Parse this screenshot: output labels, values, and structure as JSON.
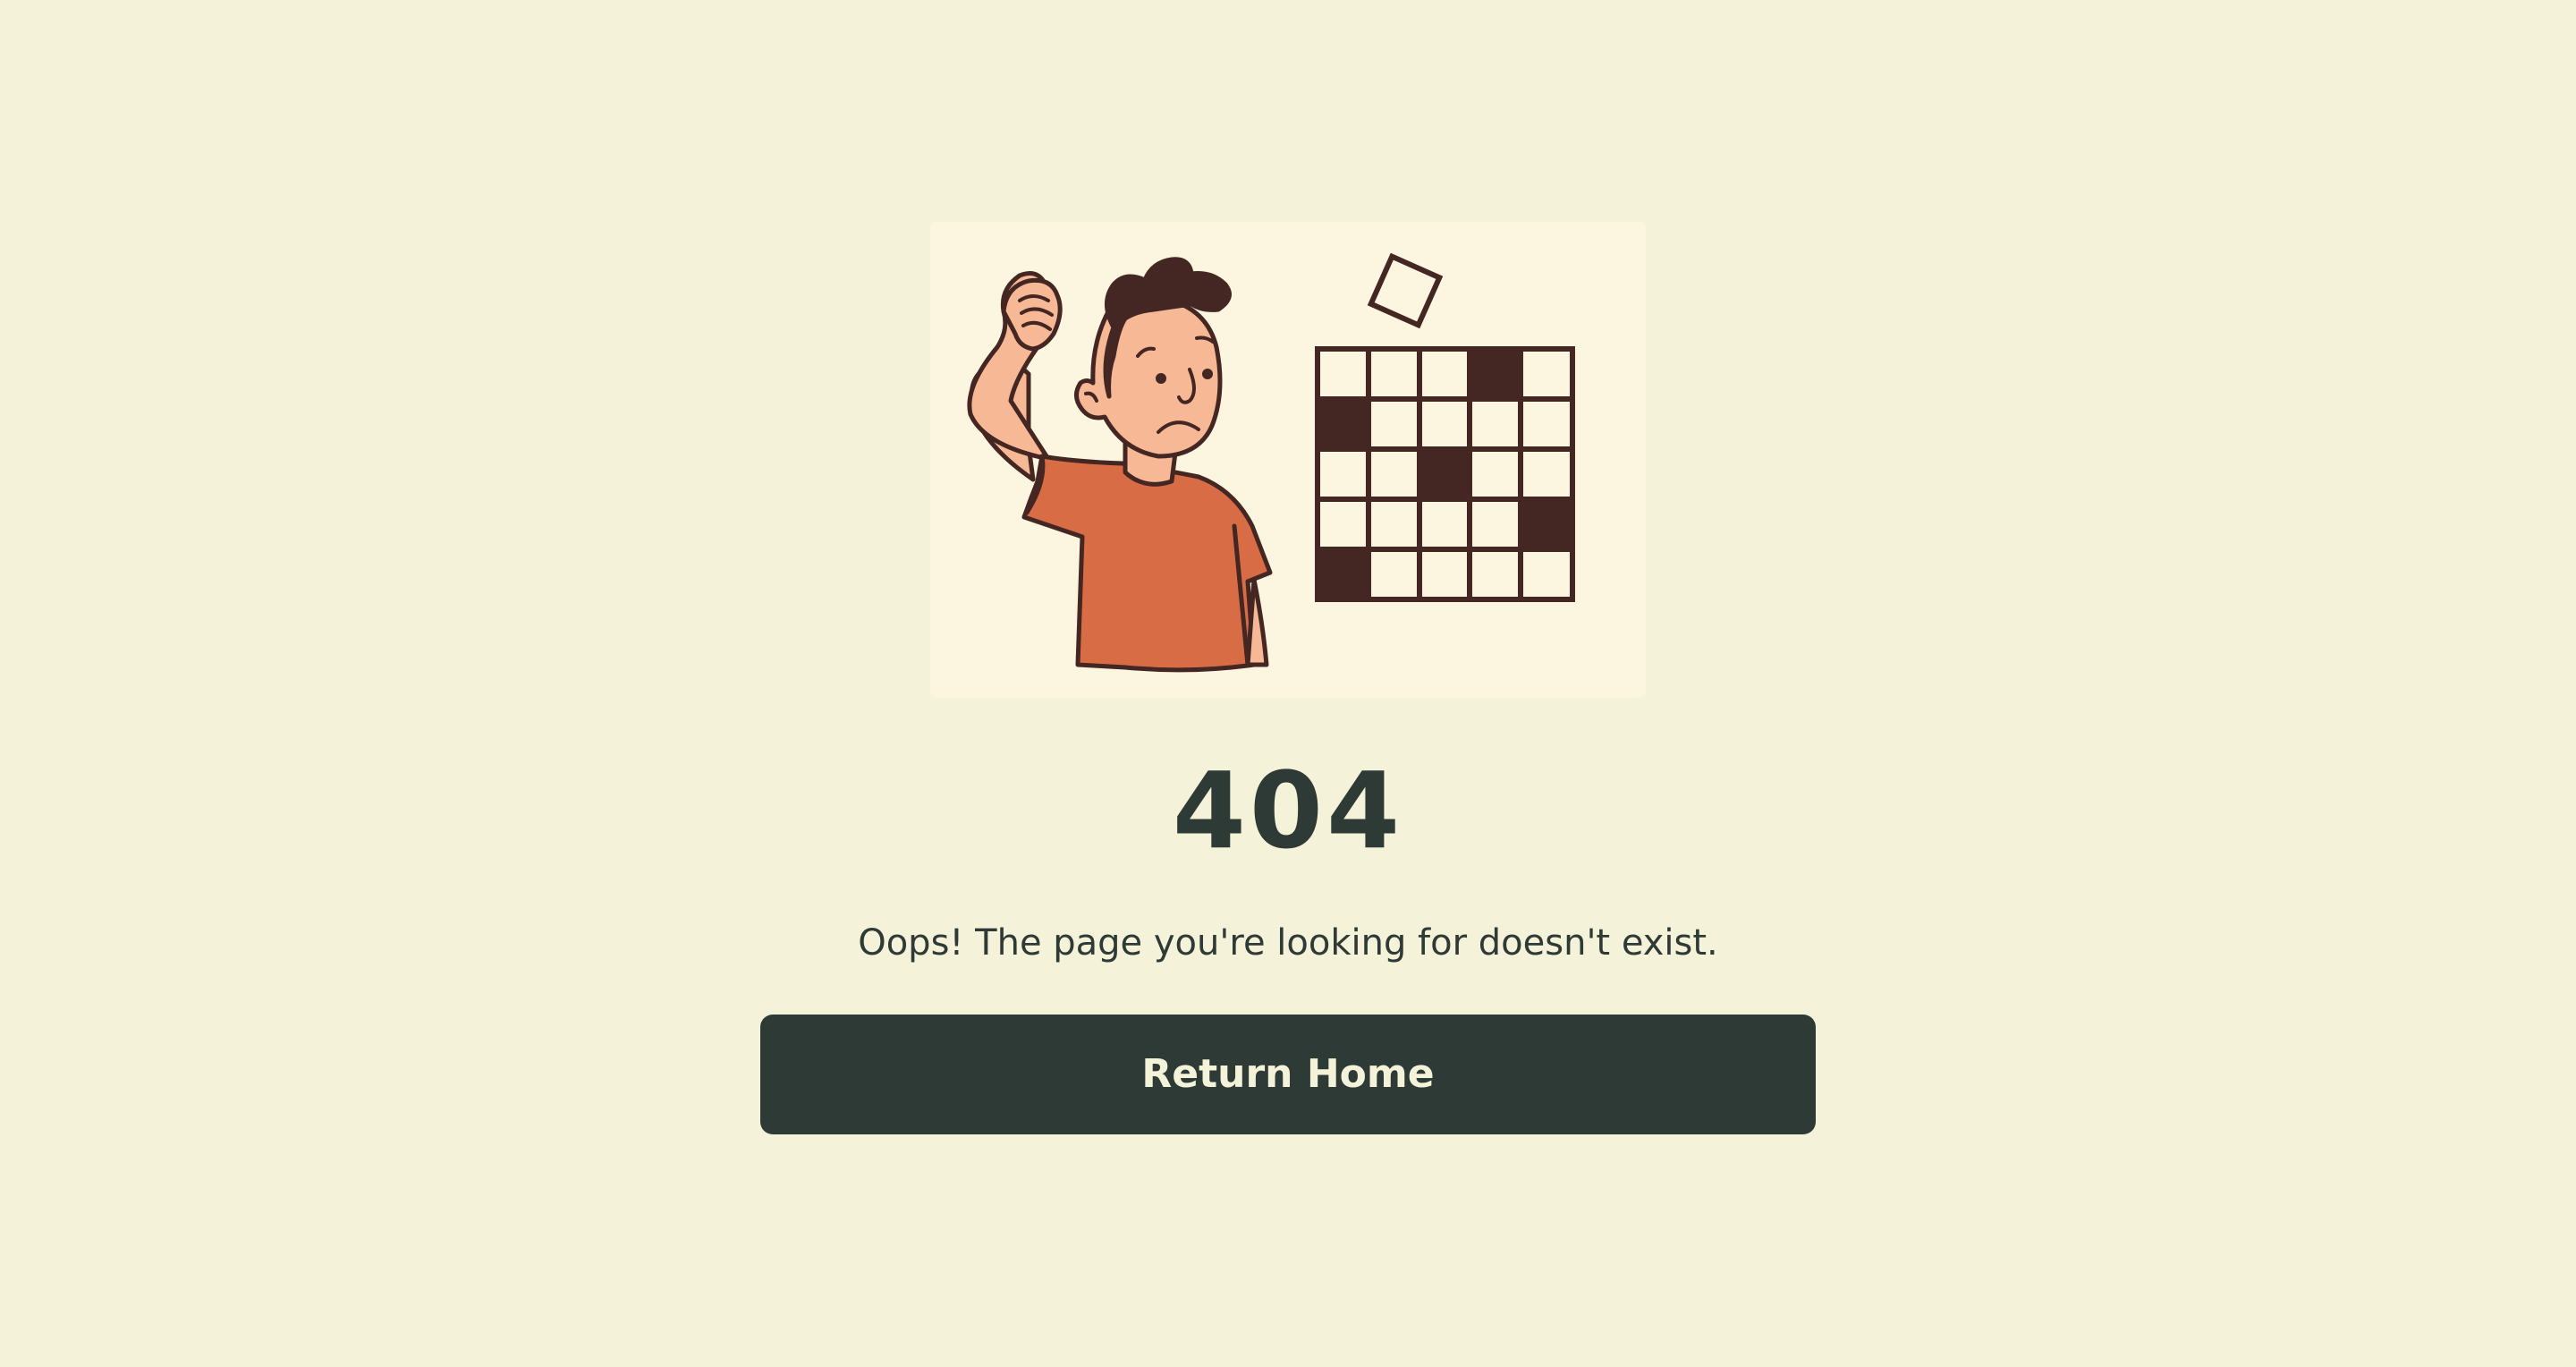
{
  "error": {
    "code": "404",
    "message": "Oops! The page you're looking for doesn't exist."
  },
  "actions": {
    "return_home_label": "Return Home"
  },
  "illustration": {
    "subject": "confused-person-with-crossword-icon"
  },
  "colors": {
    "background": "#f4f2d9",
    "illustration_bg": "#fcf5df",
    "text_dark": "#2e3a35",
    "button_bg": "#2e3a35",
    "button_text": "#f4f2d9",
    "shirt": "#d86d45",
    "skin": "#f7b995",
    "hair": "#442622"
  }
}
